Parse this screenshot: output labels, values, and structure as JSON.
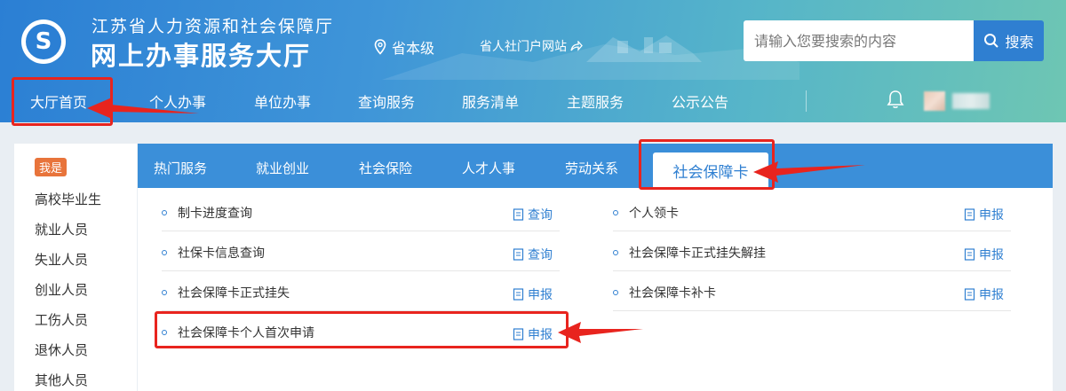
{
  "header": {
    "org_name": "江苏省人力资源和社会保障厅",
    "site_name": "网上办事服务大厅",
    "logo_letter": "S",
    "region": "省本级",
    "portal_link": "省人社门户网站",
    "search_placeholder": "请输入您要搜索的内容",
    "search_button": "搜索"
  },
  "nav": {
    "items": [
      "大厅首页",
      "个人办事",
      "单位办事",
      "查询服务",
      "服务清单",
      "主题服务",
      "公示公告"
    ]
  },
  "sidebar": {
    "badge": "我是",
    "items": [
      "高校毕业生",
      "就业人员",
      "失业人员",
      "创业人员",
      "工伤人员",
      "退休人员",
      "其他人员"
    ]
  },
  "tabs": {
    "items": [
      "热门服务",
      "就业创业",
      "社会保险",
      "人才人事",
      "劳动关系"
    ],
    "active": "社会保障卡"
  },
  "services": {
    "left": [
      {
        "label": "制卡进度查询",
        "action": "查询"
      },
      {
        "label": "社保卡信息查询",
        "action": "查询"
      },
      {
        "label": "社会保障卡正式挂失",
        "action": "申报"
      },
      {
        "label": "社会保障卡个人首次申请",
        "action": "申报"
      }
    ],
    "right": [
      {
        "label": "个人领卡",
        "action": "申报"
      },
      {
        "label": "社会保障卡正式挂失解挂",
        "action": "申报"
      },
      {
        "label": "社会保障卡补卡",
        "action": "申报"
      }
    ]
  },
  "colors": {
    "primary": "#2f7fd1",
    "tab_bar": "#3b8fd9",
    "annotation_red": "#e8241e",
    "badge": "#e8743b"
  }
}
